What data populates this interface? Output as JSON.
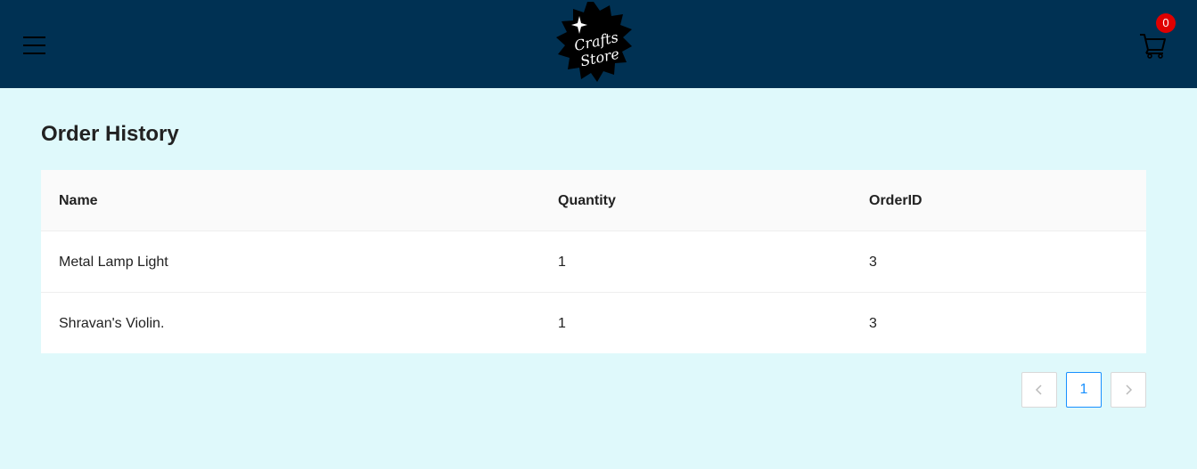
{
  "header": {
    "logo_line1": "Crafts",
    "logo_line2": "Store",
    "cart_count": "0",
    "icons": {
      "menu": "hamburger-menu-icon",
      "cart": "shopping-cart-icon",
      "logo": "crafts-store-logo"
    }
  },
  "page": {
    "title": "Order History"
  },
  "table": {
    "columns": [
      "Name",
      "Quantity",
      "OrderID"
    ],
    "rows": [
      [
        "Metal Lamp Light",
        "1",
        "3"
      ],
      [
        "Shravan's Violin.",
        "1",
        "3"
      ]
    ]
  },
  "pagination": {
    "current_page": "1",
    "icons": {
      "prev": "chevron-left-icon",
      "next": "chevron-right-icon"
    }
  },
  "colors": {
    "header_bg": "#003153",
    "page_bg": "#dff9fb",
    "badge": "#e00000",
    "active_page": "#1890ff"
  }
}
